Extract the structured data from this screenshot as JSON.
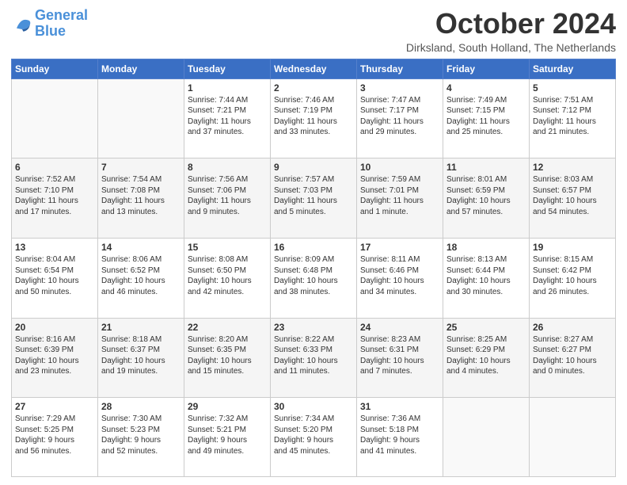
{
  "header": {
    "logo_line1": "General",
    "logo_line2": "Blue",
    "month": "October 2024",
    "location": "Dirksland, South Holland, The Netherlands"
  },
  "weekdays": [
    "Sunday",
    "Monday",
    "Tuesday",
    "Wednesday",
    "Thursday",
    "Friday",
    "Saturday"
  ],
  "weeks": [
    [
      {
        "day": "",
        "info": ""
      },
      {
        "day": "",
        "info": ""
      },
      {
        "day": "1",
        "info": "Sunrise: 7:44 AM\nSunset: 7:21 PM\nDaylight: 11 hours\nand 37 minutes."
      },
      {
        "day": "2",
        "info": "Sunrise: 7:46 AM\nSunset: 7:19 PM\nDaylight: 11 hours\nand 33 minutes."
      },
      {
        "day": "3",
        "info": "Sunrise: 7:47 AM\nSunset: 7:17 PM\nDaylight: 11 hours\nand 29 minutes."
      },
      {
        "day": "4",
        "info": "Sunrise: 7:49 AM\nSunset: 7:15 PM\nDaylight: 11 hours\nand 25 minutes."
      },
      {
        "day": "5",
        "info": "Sunrise: 7:51 AM\nSunset: 7:12 PM\nDaylight: 11 hours\nand 21 minutes."
      }
    ],
    [
      {
        "day": "6",
        "info": "Sunrise: 7:52 AM\nSunset: 7:10 PM\nDaylight: 11 hours\nand 17 minutes."
      },
      {
        "day": "7",
        "info": "Sunrise: 7:54 AM\nSunset: 7:08 PM\nDaylight: 11 hours\nand 13 minutes."
      },
      {
        "day": "8",
        "info": "Sunrise: 7:56 AM\nSunset: 7:06 PM\nDaylight: 11 hours\nand 9 minutes."
      },
      {
        "day": "9",
        "info": "Sunrise: 7:57 AM\nSunset: 7:03 PM\nDaylight: 11 hours\nand 5 minutes."
      },
      {
        "day": "10",
        "info": "Sunrise: 7:59 AM\nSunset: 7:01 PM\nDaylight: 11 hours\nand 1 minute."
      },
      {
        "day": "11",
        "info": "Sunrise: 8:01 AM\nSunset: 6:59 PM\nDaylight: 10 hours\nand 57 minutes."
      },
      {
        "day": "12",
        "info": "Sunrise: 8:03 AM\nSunset: 6:57 PM\nDaylight: 10 hours\nand 54 minutes."
      }
    ],
    [
      {
        "day": "13",
        "info": "Sunrise: 8:04 AM\nSunset: 6:54 PM\nDaylight: 10 hours\nand 50 minutes."
      },
      {
        "day": "14",
        "info": "Sunrise: 8:06 AM\nSunset: 6:52 PM\nDaylight: 10 hours\nand 46 minutes."
      },
      {
        "day": "15",
        "info": "Sunrise: 8:08 AM\nSunset: 6:50 PM\nDaylight: 10 hours\nand 42 minutes."
      },
      {
        "day": "16",
        "info": "Sunrise: 8:09 AM\nSunset: 6:48 PM\nDaylight: 10 hours\nand 38 minutes."
      },
      {
        "day": "17",
        "info": "Sunrise: 8:11 AM\nSunset: 6:46 PM\nDaylight: 10 hours\nand 34 minutes."
      },
      {
        "day": "18",
        "info": "Sunrise: 8:13 AM\nSunset: 6:44 PM\nDaylight: 10 hours\nand 30 minutes."
      },
      {
        "day": "19",
        "info": "Sunrise: 8:15 AM\nSunset: 6:42 PM\nDaylight: 10 hours\nand 26 minutes."
      }
    ],
    [
      {
        "day": "20",
        "info": "Sunrise: 8:16 AM\nSunset: 6:39 PM\nDaylight: 10 hours\nand 23 minutes."
      },
      {
        "day": "21",
        "info": "Sunrise: 8:18 AM\nSunset: 6:37 PM\nDaylight: 10 hours\nand 19 minutes."
      },
      {
        "day": "22",
        "info": "Sunrise: 8:20 AM\nSunset: 6:35 PM\nDaylight: 10 hours\nand 15 minutes."
      },
      {
        "day": "23",
        "info": "Sunrise: 8:22 AM\nSunset: 6:33 PM\nDaylight: 10 hours\nand 11 minutes."
      },
      {
        "day": "24",
        "info": "Sunrise: 8:23 AM\nSunset: 6:31 PM\nDaylight: 10 hours\nand 7 minutes."
      },
      {
        "day": "25",
        "info": "Sunrise: 8:25 AM\nSunset: 6:29 PM\nDaylight: 10 hours\nand 4 minutes."
      },
      {
        "day": "26",
        "info": "Sunrise: 8:27 AM\nSunset: 6:27 PM\nDaylight: 10 hours\nand 0 minutes."
      }
    ],
    [
      {
        "day": "27",
        "info": "Sunrise: 7:29 AM\nSunset: 5:25 PM\nDaylight: 9 hours\nand 56 minutes."
      },
      {
        "day": "28",
        "info": "Sunrise: 7:30 AM\nSunset: 5:23 PM\nDaylight: 9 hours\nand 52 minutes."
      },
      {
        "day": "29",
        "info": "Sunrise: 7:32 AM\nSunset: 5:21 PM\nDaylight: 9 hours\nand 49 minutes."
      },
      {
        "day": "30",
        "info": "Sunrise: 7:34 AM\nSunset: 5:20 PM\nDaylight: 9 hours\nand 45 minutes."
      },
      {
        "day": "31",
        "info": "Sunrise: 7:36 AM\nSunset: 5:18 PM\nDaylight: 9 hours\nand 41 minutes."
      },
      {
        "day": "",
        "info": ""
      },
      {
        "day": "",
        "info": ""
      }
    ]
  ]
}
